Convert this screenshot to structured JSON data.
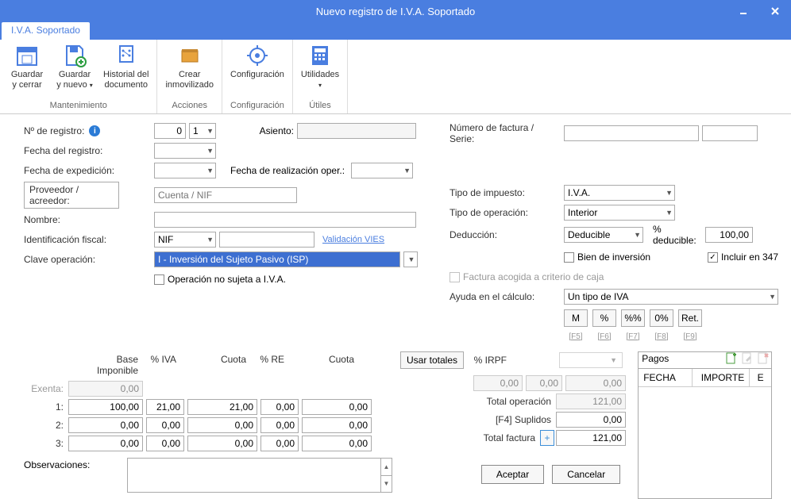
{
  "window": {
    "title": "Nuevo registro de I.V.A. Soportado",
    "tab": "I.V.A. Soportado"
  },
  "ribbon": {
    "groups": {
      "mantenimiento": "Mantenimiento",
      "acciones": "Acciones",
      "configuracion": "Configuración",
      "utiles": "Útiles"
    },
    "buttons": {
      "guardar_cerrar_l1": "Guardar",
      "guardar_cerrar_l2": "y cerrar",
      "guardar_nuevo_l1": "Guardar",
      "guardar_nuevo_l2": "y nuevo",
      "historial_l1": "Historial del",
      "historial_l2": "documento",
      "crear_l1": "Crear",
      "crear_l2": "inmovilizado",
      "configuracion": "Configuración",
      "utilidades": "Utilidades"
    }
  },
  "labels": {
    "num_registro": "Nº de registro:",
    "fecha_registro": "Fecha del registro:",
    "fecha_expedicion": "Fecha de expedición:",
    "fecha_realizacion": "Fecha de realización oper.:",
    "proveedor": "Proveedor / acreedor:",
    "nombre": "Nombre:",
    "ident_fiscal": "Identificación fiscal:",
    "clave_op": "Clave operación:",
    "op_no_sujeta": "Operación no sujeta a I.V.A.",
    "asiento": "Asiento:",
    "num_factura": "Número de factura / Serie:",
    "tipo_impuesto": "Tipo de impuesto:",
    "tipo_operacion": "Tipo de operación:",
    "deduccion": "Deducción:",
    "pct_deducible": "% deducible:",
    "bien_inversion": "Bien de inversión",
    "incluir_347": "Incluir en 347",
    "factura_caja": "Factura acogida a criterio de caja",
    "ayuda_calculo": "Ayuda en el cálculo:",
    "validacion_vies": "Validación VIES",
    "observaciones": "Observaciones:",
    "pagos": "Pagos",
    "usar_totales": "Usar totales",
    "aceptar": "Aceptar",
    "cancelar": "Cancelar"
  },
  "values": {
    "num_registro": "0",
    "num_registro_serie": "1",
    "proveedor_placeholder": "Cuenta / NIF",
    "ident_fiscal_tipo": "NIF",
    "clave_op": "I - Inversión del Sujeto Pasivo (ISP)",
    "tipo_impuesto": "I.V.A.",
    "tipo_operacion": "Interior",
    "deduccion": "Deducible",
    "pct_deducible": "100,00",
    "ayuda_calculo": "Un tipo de IVA",
    "irpf_label": "% IRPF"
  },
  "calc_buttons": [
    {
      "label": "M",
      "key": "[F5]"
    },
    {
      "label": "%",
      "key": "[F6]"
    },
    {
      "label": "%%",
      "key": "[F7]"
    },
    {
      "label": "0%",
      "key": "[F8]"
    },
    {
      "label": "Ret.",
      "key": "[F9]"
    }
  ],
  "grid": {
    "headers": {
      "base": "Base Imponible",
      "pct_iva": "% IVA",
      "cuota1": "Cuota",
      "pct_re": "% RE",
      "cuota2": "Cuota"
    },
    "rows": [
      {
        "label": "Exenta:",
        "base": "0,00",
        "disabled": true
      },
      {
        "label": "1:",
        "base": "100,00",
        "pct_iva": "21,00",
        "cuota1": "21,00",
        "pct_re": "0,00",
        "cuota2": "0,00"
      },
      {
        "label": "2:",
        "base": "0,00",
        "pct_iva": "0,00",
        "cuota1": "0,00",
        "pct_re": "0,00",
        "cuota2": "0,00"
      },
      {
        "label": "3:",
        "base": "0,00",
        "pct_iva": "0,00",
        "cuota1": "0,00",
        "pct_re": "0,00",
        "cuota2": "0,00"
      }
    ]
  },
  "totals": {
    "irpf_base": "0,00",
    "irpf_pct": "0,00",
    "irpf_cuota": "0,00",
    "total_op_label": "Total operación",
    "total_op": "121,00",
    "suplidos_label": "[F4] Suplidos",
    "suplidos": "0,00",
    "total_fact_label": "Total factura",
    "total_fact": "121,00",
    "plus": "+"
  },
  "pagos_table": {
    "cols": {
      "fecha": "FECHA",
      "importe": "IMPORTE",
      "e": "E"
    }
  }
}
